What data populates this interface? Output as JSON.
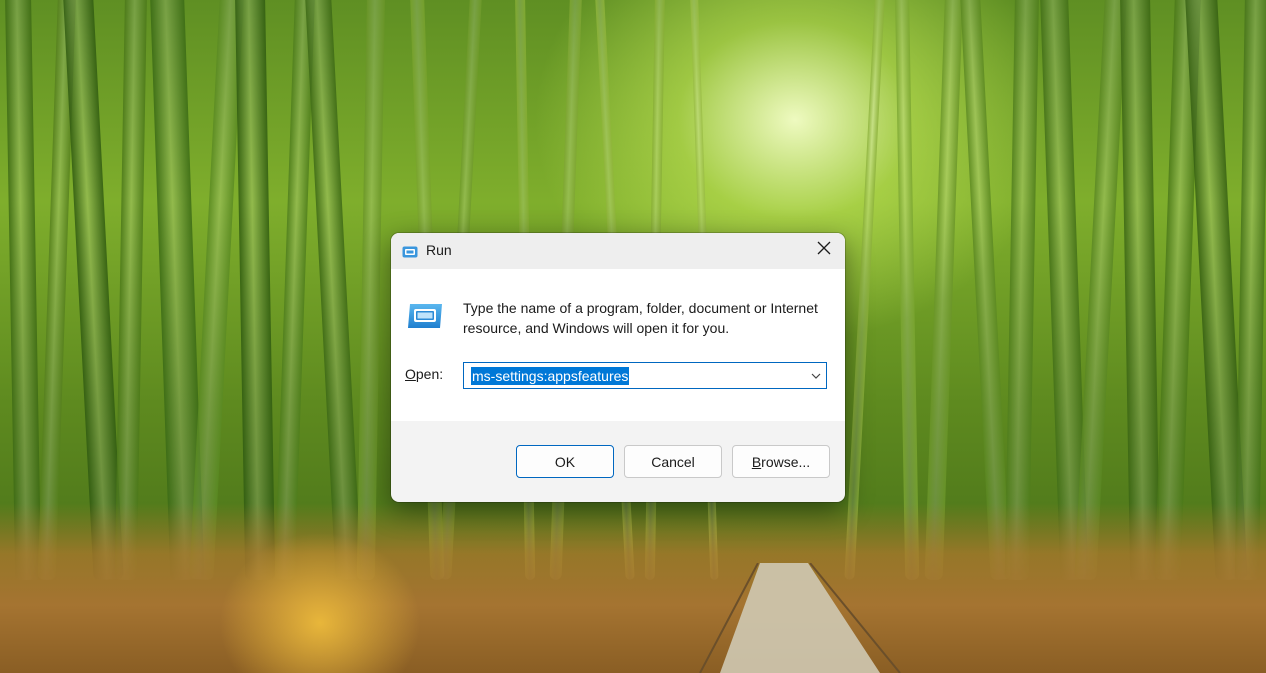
{
  "dialog": {
    "title": "Run",
    "instruction": "Type the name of a program, folder, document or Internet resource, and Windows will open it for you.",
    "open_label_accel": "O",
    "open_label_rest": "pen:",
    "open_value": "ms-settings:appsfeatures",
    "ok_label": "OK",
    "cancel_label": "Cancel",
    "browse_label_accel": "B",
    "browse_label_rest": "rowse...",
    "accent_color": "#0067c0",
    "selection_color": "#0078d7"
  },
  "icons": {
    "title": "run-app-icon",
    "content": "run-app-large-icon",
    "close": "close-icon",
    "dropdown": "chevron-down-icon"
  }
}
